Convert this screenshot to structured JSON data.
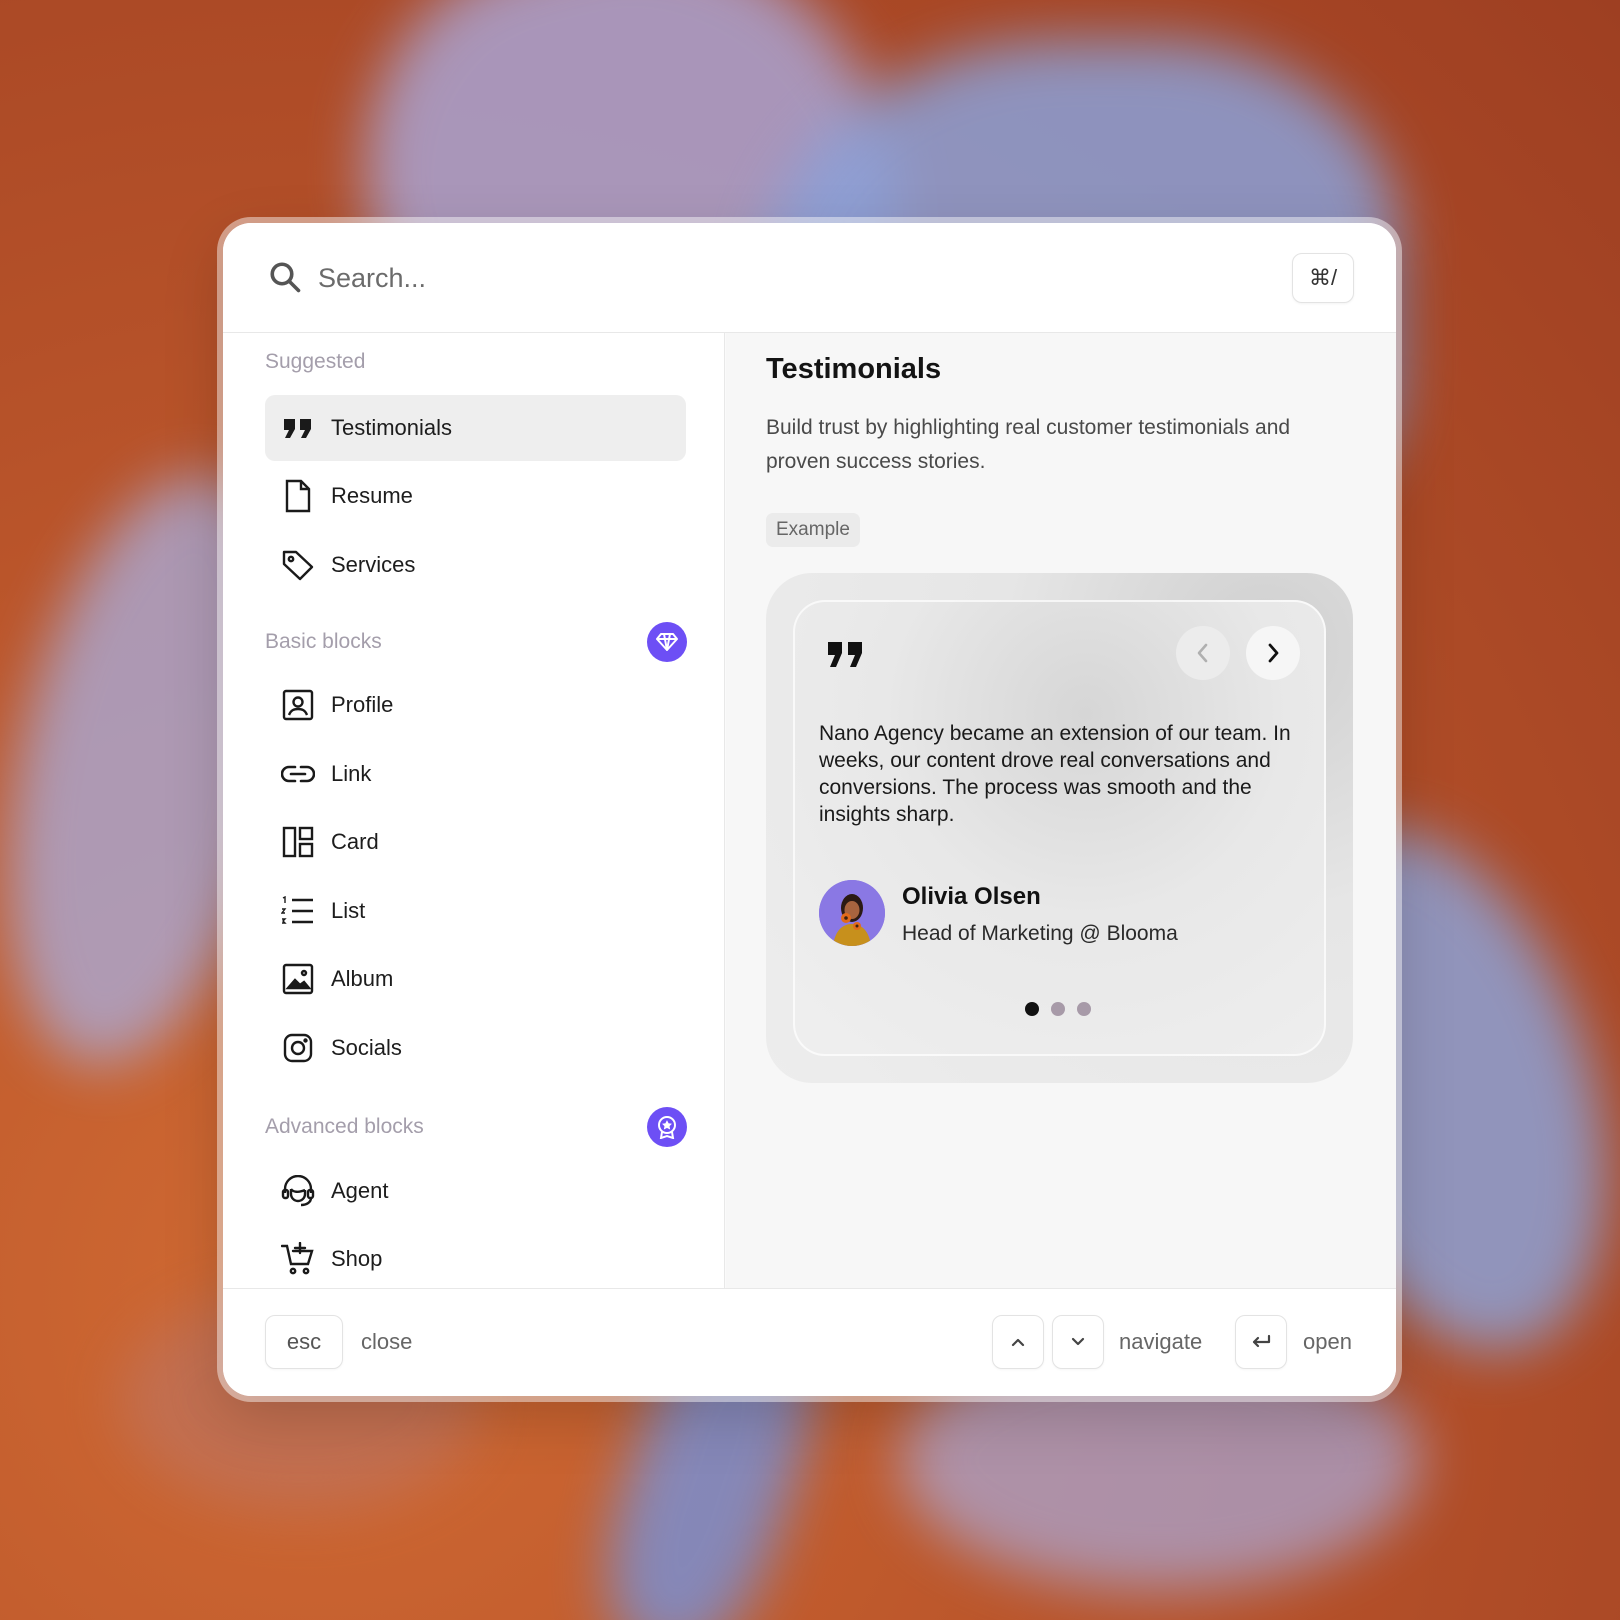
{
  "search": {
    "placeholder": "Search...",
    "shortcut": "⌘/"
  },
  "sidebar": {
    "sections": [
      {
        "title": "Suggested",
        "badge": null,
        "items": [
          {
            "label": "Testimonials",
            "icon": "quote-icon",
            "active": true
          },
          {
            "label": "Resume",
            "icon": "document-icon",
            "active": false
          },
          {
            "label": "Services",
            "icon": "tag-icon",
            "active": false
          }
        ]
      },
      {
        "title": "Basic blocks",
        "badge": "diamond-icon",
        "items": [
          {
            "label": "Profile",
            "icon": "profile-icon"
          },
          {
            "label": "Link",
            "icon": "link-icon"
          },
          {
            "label": "Card",
            "icon": "card-layout-icon"
          },
          {
            "label": "List",
            "icon": "numbered-list-icon"
          },
          {
            "label": "Album",
            "icon": "image-icon"
          },
          {
            "label": "Socials",
            "icon": "instagram-icon"
          }
        ]
      },
      {
        "title": "Advanced blocks",
        "badge": "award-icon",
        "items": [
          {
            "label": "Agent",
            "icon": "headset-agent-icon"
          },
          {
            "label": "Shop",
            "icon": "cart-plus-icon"
          }
        ]
      }
    ]
  },
  "detail": {
    "title": "Testimonials",
    "description": "Build trust by highlighting real customer testimonials and proven success stories.",
    "tag": "Example",
    "preview": {
      "quote": "Nano Agency became an extension of our team. In weeks, our content drove real conversations and conversions.  The process was smooth and the insights sharp.",
      "author_name": "Olivia Olsen",
      "author_role": "Head of Marketing @ Blooma",
      "slide_count": 3,
      "active_slide": 1
    }
  },
  "footer": {
    "esc_key": "esc",
    "close_label": "close",
    "navigate_label": "navigate",
    "open_label": "open"
  },
  "colors": {
    "accent": "#6d4ff5",
    "selected_bg": "#eeeeee",
    "section_title": "#a49eab"
  }
}
